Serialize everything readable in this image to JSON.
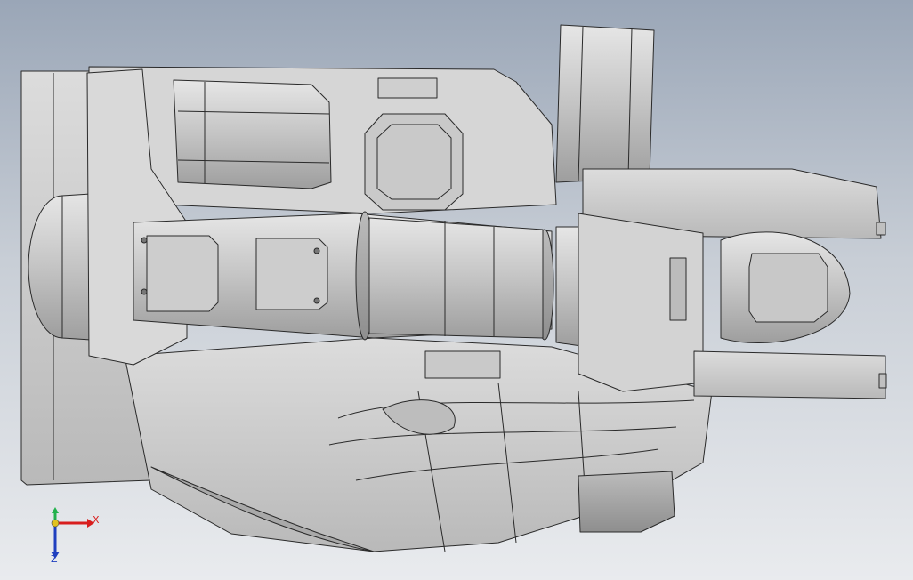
{
  "viewport": {
    "background": "#c8ced6",
    "model_fill": "#d2d2d2",
    "model_edge": "#2a2a2a"
  },
  "triad": {
    "x_label": "X",
    "z_label": "Z",
    "y_label": "",
    "x_color": "#d81e1e",
    "y_color": "#22b14c",
    "z_color": "#1f3fbf"
  }
}
